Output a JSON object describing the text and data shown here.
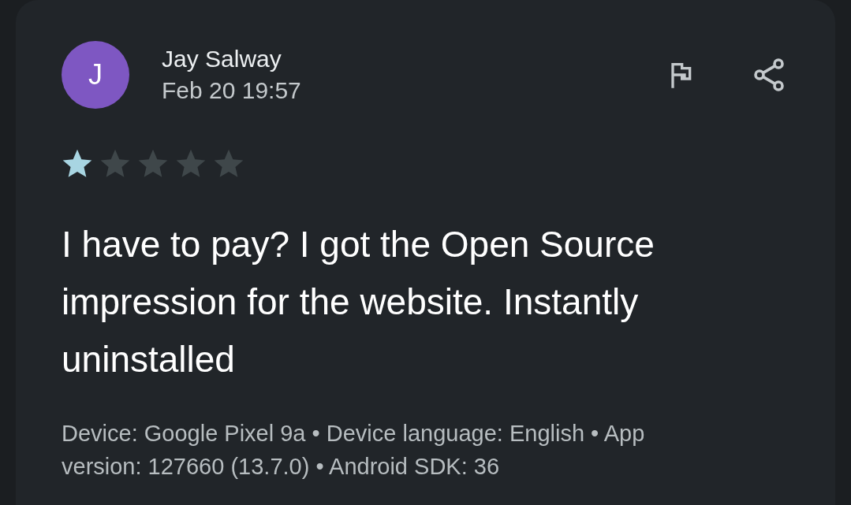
{
  "review": {
    "avatar": {
      "letter": "J",
      "color": "#7e57c2"
    },
    "author": "Jay Salway",
    "date": "Feb 20 19:57",
    "stars": 1,
    "text": "I have to pay? I got the Open Source impression for the website. Instantly uninstalled",
    "details": "Device: Google Pixel 9a • Device language: English • App version: 127660 (13.7.0) • Android SDK: 36"
  }
}
